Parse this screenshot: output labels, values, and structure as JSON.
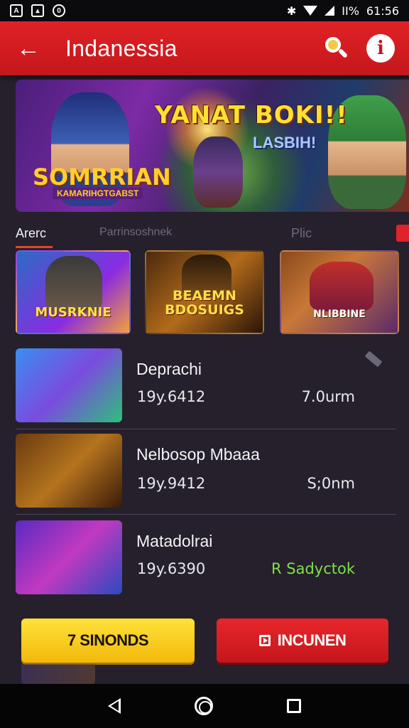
{
  "status_bar": {
    "battery": "%",
    "time": "61:56",
    "signal_text": "II%"
  },
  "app_bar": {
    "title": "Indanessia"
  },
  "hero": {
    "title": "YANAT BOKI!!",
    "subtitle": "LASBIH!",
    "logo": "SOMRRIAN",
    "logo_sub": "KAMARIHGTGABST"
  },
  "tabs": [
    {
      "label": "Arerc"
    },
    {
      "label": "Parrinsoshnek"
    },
    {
      "label": "Plic"
    }
  ],
  "thumbnails": [
    {
      "label": "MUSRKNIE"
    },
    {
      "label": "BEAEMN BDOSUIGS"
    },
    {
      "label": "NLIBBINE"
    }
  ],
  "list": [
    {
      "name": "Deprachi",
      "meta": "19y.6412",
      "value": "7.0urm",
      "value_color": "#eaeaee"
    },
    {
      "name": "Nelbosop Mbaaa",
      "meta": "19y.9412",
      "value": "S;0nm",
      "value_color": "#eaeaee"
    },
    {
      "name": "Matadolrai",
      "meta": "19y.6390",
      "value": "R Sadyctok",
      "value_color": "#7ee04a"
    }
  ],
  "buttons": {
    "primary_label": "7 SINONDS",
    "secondary_label": "INCUNEN"
  },
  "icons": {
    "back": "arrow-left-icon",
    "search": "search-icon",
    "info": "info-icon",
    "edit": "pencil-icon",
    "play": "play-icon"
  },
  "colors": {
    "accent_red": "#e02226",
    "accent_yellow": "#ffe23a",
    "background": "#25202b",
    "success_green": "#7ee04a"
  }
}
